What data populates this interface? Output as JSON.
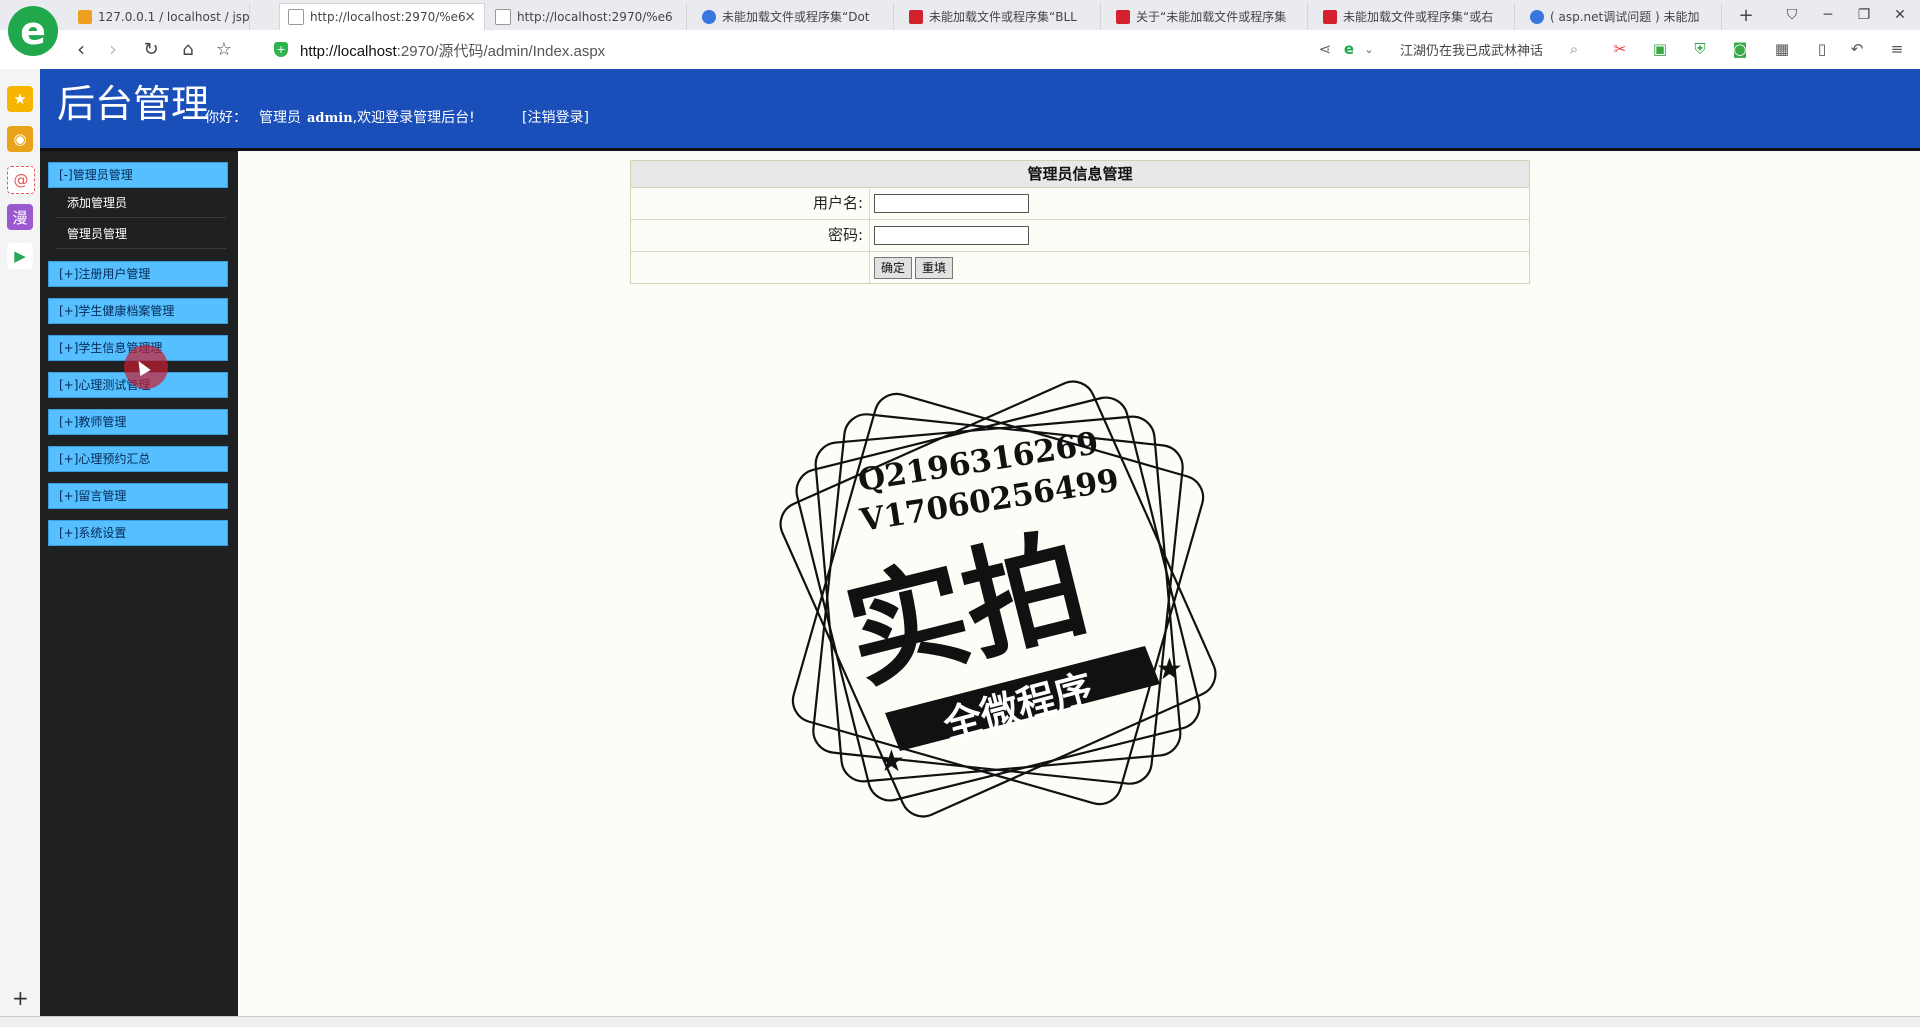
{
  "browser": {
    "logo_letter": "e",
    "tabs": [
      {
        "label": "127.0.0.1 / localhost / jsp",
        "icon": "phpmyadmin-icon",
        "active": false
      },
      {
        "label": "http://localhost:2970/%e6",
        "icon": "page-icon",
        "active": true
      },
      {
        "label": "http://localhost:2970/%e6",
        "icon": "page-icon",
        "active": false
      },
      {
        "label": "未能加载文件或程序集“Dot",
        "icon": "baidu-paw-icon",
        "active": false
      },
      {
        "label": "未能加载文件或程序集“BLL",
        "icon": "csdn-icon",
        "active": false
      },
      {
        "label": "关于“未能加载文件或程序集",
        "icon": "csdn-icon",
        "active": false
      },
      {
        "label": "未能加载文件或程序集“或右",
        "icon": "csdn-icon",
        "active": false
      },
      {
        "label": "( asp.net调试问题 ) 未能加",
        "icon": "baidu-paw-icon",
        "active": false
      }
    ],
    "tab_close": "×",
    "new_tab": "+",
    "address_host": "http://localhost",
    "address_rest": ":2970/源代码/admin/Index.aspx",
    "search_text": "江湖仍在我已成武林神话",
    "colors": {
      "brand_green": "#21a84d",
      "header_blue": "#1a4fba",
      "menu_blue": "#55bfff",
      "menu_bg": "#1f2021"
    }
  },
  "page": {
    "title": "后台管理",
    "greeting": "你好：",
    "role": "管理员",
    "username": "admin",
    "welcome": ",欢迎登录管理后台!",
    "logout": "[注销登录]"
  },
  "menu": {
    "groups": [
      {
        "title": "[-]管理员管理",
        "items": [
          "添加管理员",
          "管理员管理"
        ]
      },
      {
        "title": "[+]注册用户管理"
      },
      {
        "title": "[+]学生健康档案管理"
      },
      {
        "title": "[+]学生信息管理理"
      },
      {
        "title": "[+]心理测试管理"
      },
      {
        "title": "[+]教师管理"
      },
      {
        "title": "[+]心理预约汇总"
      },
      {
        "title": "[+]留言管理"
      },
      {
        "title": "[+]系统设置"
      }
    ]
  },
  "form": {
    "title": "管理员信息管理",
    "username_label": "用户名:",
    "password_label": "密码:",
    "username_value": "",
    "password_value": "",
    "submit": "确定",
    "reset": "重填"
  },
  "stamp": {
    "line1": "Q2196316269",
    "line2": "V17060256499",
    "main": "实拍",
    "ribbon": "全微程序"
  }
}
